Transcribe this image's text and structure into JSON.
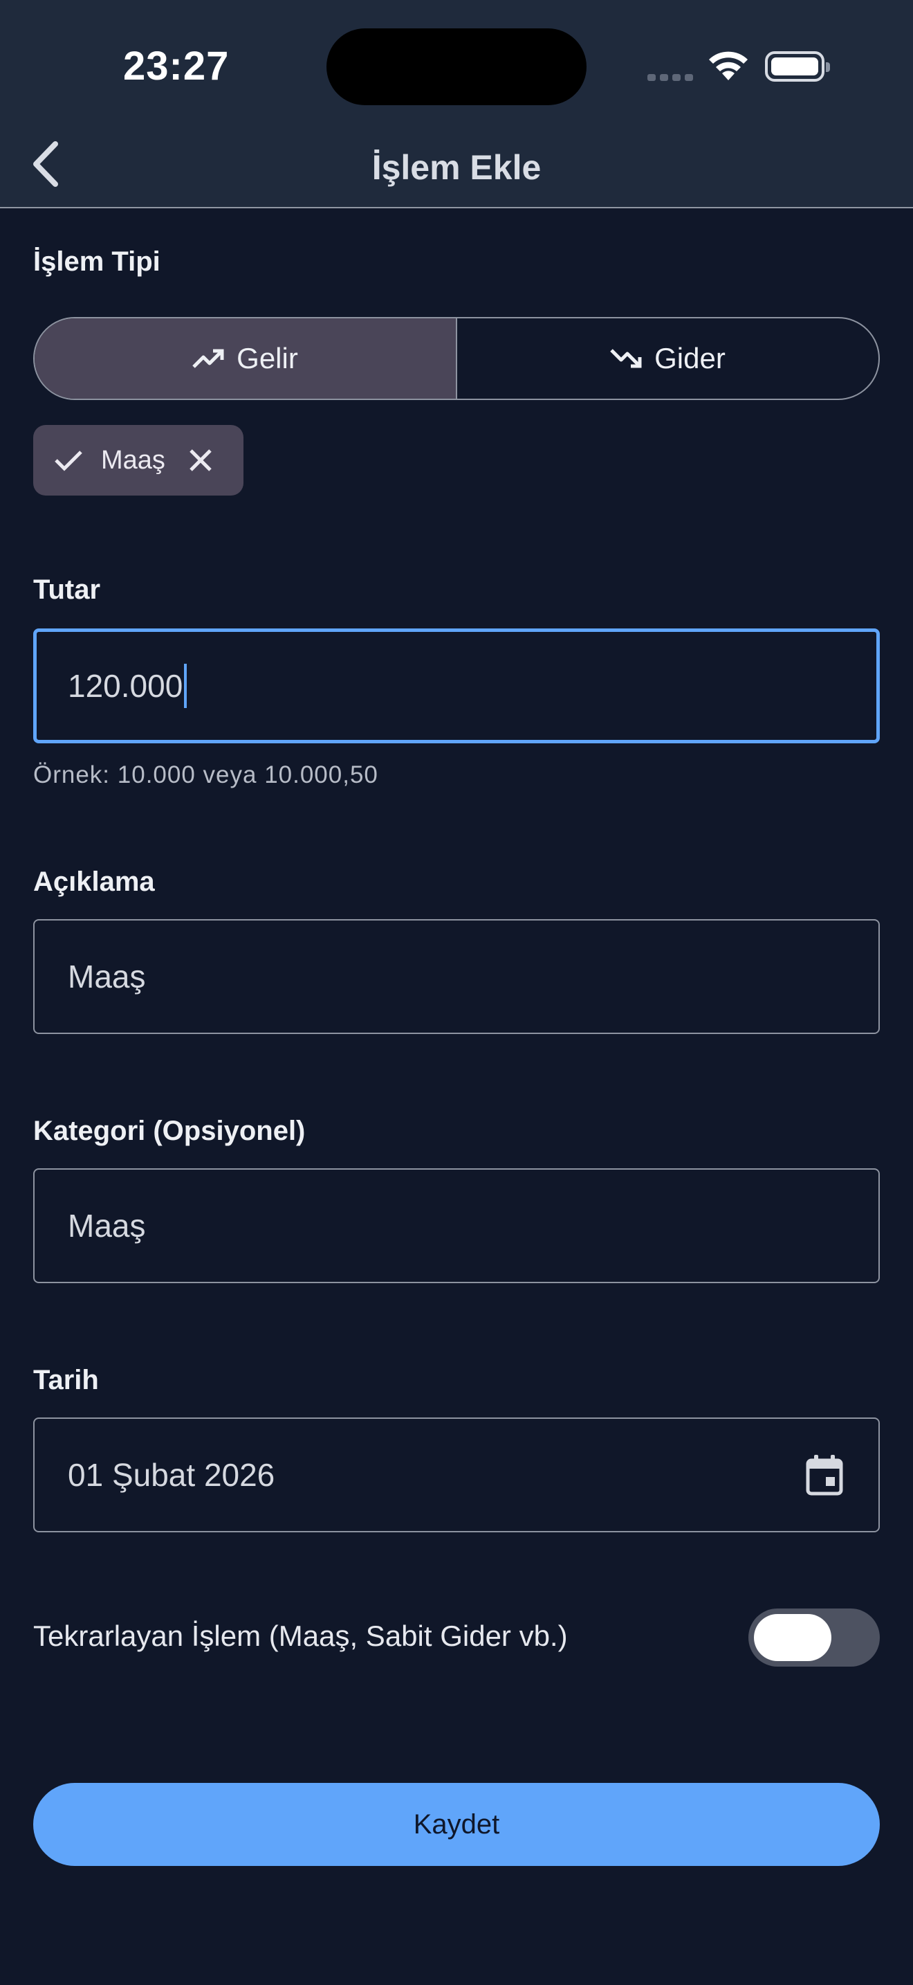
{
  "status_bar": {
    "time": "23:27"
  },
  "app_bar": {
    "title": "İşlem Ekle"
  },
  "type_section": {
    "label": "İşlem Tipi",
    "options": [
      {
        "label": "Gelir",
        "icon": "trending-up-icon",
        "selected": true
      },
      {
        "label": "Gider",
        "icon": "trending-down-icon",
        "selected": false
      }
    ]
  },
  "chip": {
    "label": "Maaş",
    "selected": true
  },
  "amount": {
    "label": "Tutar",
    "value": "120.000",
    "helper": "Örnek: 10.000 veya 10.000,50"
  },
  "description": {
    "label": "Açıklama",
    "value": "Maaş"
  },
  "category": {
    "label": "Kategori (Opsiyonel)",
    "value": "Maaş"
  },
  "date": {
    "label": "Tarih",
    "value": "01 Şubat 2026"
  },
  "recurring": {
    "label": "Tekrarlayan İşlem (Maaş, Sabit Gider vb.)",
    "enabled": false
  },
  "save_button": {
    "label": "Kaydet"
  },
  "colors": {
    "background": "#101729",
    "app_bar": "#1f2a3c",
    "accent": "#60a5fa",
    "selected_segment": "#4a4558",
    "border": "#8d93a0"
  }
}
